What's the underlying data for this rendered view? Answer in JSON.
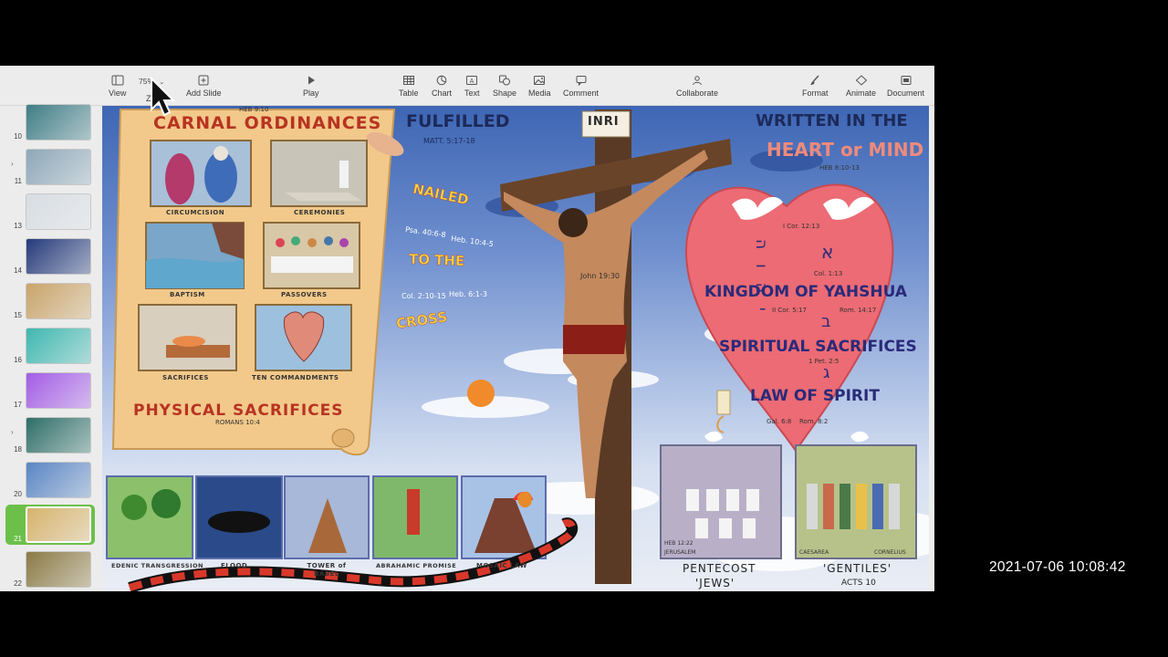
{
  "toolbar": {
    "view": "View",
    "zoom_value": "75%",
    "zoom_label": "Zoom",
    "add_slide": "Add Slide",
    "play": "Play",
    "table": "Table",
    "chart": "Chart",
    "text": "Text",
    "shape": "Shape",
    "media": "Media",
    "comment": "Comment",
    "collaborate": "Collaborate",
    "format": "Format",
    "animate": "Animate",
    "document": "Document"
  },
  "navigator": {
    "slides": [
      {
        "number": "10",
        "has_disclosure": false,
        "color": "#3f7d86"
      },
      {
        "number": "11",
        "has_disclosure": true,
        "color": "#8da7b8"
      },
      {
        "number": "13",
        "has_disclosure": false,
        "color": "#d7dde3"
      },
      {
        "number": "14",
        "has_disclosure": false,
        "color": "#243a7a"
      },
      {
        "number": "15",
        "has_disclosure": false,
        "color": "#c9a46a"
      },
      {
        "number": "16",
        "has_disclosure": false,
        "color": "#3fb7b0"
      },
      {
        "number": "17",
        "has_disclosure": false,
        "color": "#a35ce6"
      },
      {
        "number": "18",
        "has_disclosure": true,
        "color": "#2e6e68"
      },
      {
        "number": "20",
        "has_disclosure": false,
        "color": "#5a86c4"
      },
      {
        "number": "21",
        "has_disclosure": false,
        "color": "#d6b36c",
        "selected": true
      },
      {
        "number": "22",
        "has_disclosure": false,
        "color": "#8a7a45"
      }
    ]
  },
  "slide": {
    "scroll": {
      "heb_ref": "HEB 9:10",
      "title": "CARNAL ORDINANCES",
      "captions": [
        "CIRCUMCISION",
        "CEREMONIES",
        "BAPTISM",
        "PASSOVERS",
        "SACRIFICES",
        "TEN COMMANDMENTS"
      ],
      "bottom_title": "PHYSICAL SACRIFICES",
      "bottom_ref": "ROMANS 10:4"
    },
    "middle": {
      "fulfilled": "FULFILLED",
      "matt_ref": "MATT. 5:17-18",
      "nailed": "NAILED",
      "ref1a": "Psa. 40:6-8",
      "ref1b": "Heb. 10:4-5",
      "to_the": "TO THE",
      "ref2a": "Col. 2:10-15",
      "ref2b": "Heb. 6:1-3",
      "cross": "CROSS",
      "inri": "INRI",
      "john_ref": "John 19:30"
    },
    "heart": {
      "written": "WRITTEN IN THE",
      "heart_or_mind": "HEART or MIND",
      "heb_ref": "HEB 8:10-13",
      "cor_ref": "I Cor. 12:13",
      "aleph": "א",
      "col_ref": "Col. 1:13",
      "kingdom": "KINGDOM OF YAHSHUA",
      "cor2_ref": "II Cor. 5:17",
      "rom_ref": "Rom. 14:17",
      "bet": "ב",
      "spiritual": "SPIRITUAL SACRIFICES",
      "pet_ref": "1 Pet. 2:5",
      "gimel": "ג",
      "law": "LAW OF SPIRIT",
      "gal_ref": "Gal. 6:8",
      "rom2_ref": "Rom. 8:2",
      "side_letters": "יהוה"
    },
    "bottom_panels": [
      {
        "caption": "EDENIC TRANSGRESSION"
      },
      {
        "caption": "FLOOD"
      },
      {
        "caption": "TOWER of BABEL"
      },
      {
        "caption": "ABRAHAMIC PROMISE"
      },
      {
        "caption": "MOSAIC LAW"
      }
    ],
    "pentecost": {
      "heb_ref": "HEB 12:22",
      "place": "JERUSALEM",
      "title": "PENTECOST",
      "sub": "'JEWS'"
    },
    "gentiles": {
      "place_left": "CAESAREA",
      "place_right": "CORNELIUS",
      "title": "'GENTILES'",
      "sub": "ACTS 10"
    }
  },
  "timestamp": "2021-07-06  10:08:42",
  "colors": {
    "toolbar_bg": "#ececec",
    "selection_green": "#6cc04a",
    "scroll_parchment": "#f2c98a",
    "title_red": "#b83322",
    "heart_pink": "#ec6b74",
    "heart_text": "#2a2a7a"
  }
}
